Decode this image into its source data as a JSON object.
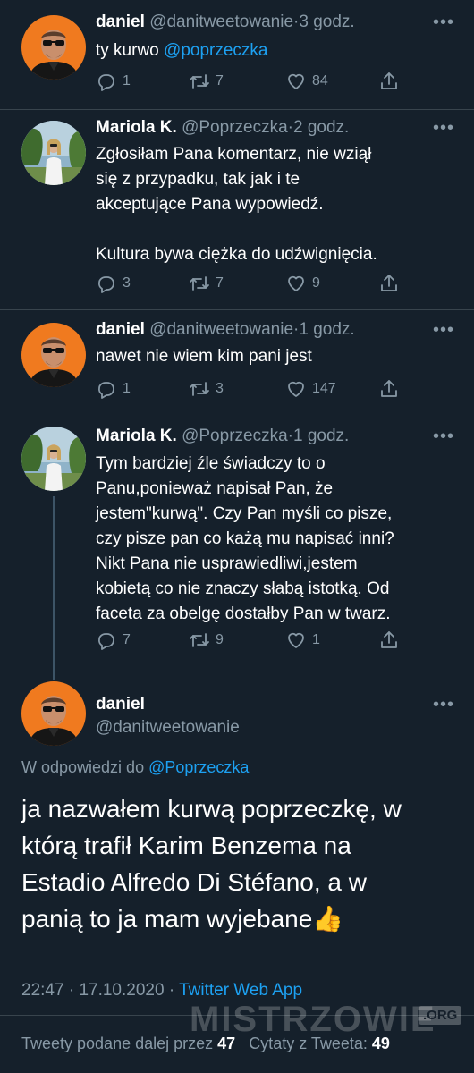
{
  "colors": {
    "background": "#15202b",
    "text": "#ffffff",
    "muted": "#8899a6",
    "link": "#1da1f2"
  },
  "tweets": [
    {
      "name": "daniel",
      "handle": "@danitweetowanie",
      "sep": "·",
      "time": "3 godz.",
      "text": "ty kurwo ",
      "mention": "@poprzeczka",
      "replies": "1",
      "retweets": "7",
      "likes": "84"
    },
    {
      "name": "Mariola K.",
      "handle": "@Poprzeczka",
      "sep": "·",
      "time": "2 godz.",
      "text_lines": [
        "Zgłosiłam Pana komentarz, nie wziął",
        "się z przypadku, tak jak i te",
        "akceptujące Pana wypowiedź.",
        "",
        "Kultura bywa ciężka do udźwignięcia."
      ],
      "replies": "3",
      "retweets": "7",
      "likes": "9"
    },
    {
      "name": "daniel",
      "handle": "@danitweetowanie",
      "sep": "·",
      "time": "1 godz.",
      "text": "nawet nie wiem kim pani jest",
      "replies": "1",
      "retweets": "3",
      "likes": "147"
    },
    {
      "name": "Mariola K.",
      "handle": "@Poprzeczka",
      "sep": "·",
      "time": "1 godz.",
      "text_lines": [
        "Tym bardziej źle świadczy to o",
        "Panu,ponieważ napisał Pan, że",
        "jestem\"kurwą\". Czy Pan myśli co pisze,",
        "czy pisze pan co każą mu napisać inni?",
        "Nikt Pana nie usprawiedliwi,jestem",
        "kobietą co nie znaczy słabą istotką. Od",
        "faceta za obelgę dostałby Pan w twarz."
      ],
      "replies": "7",
      "retweets": "9",
      "likes": "1"
    }
  ],
  "main_tweet": {
    "name": "daniel",
    "handle": "@danitweetowanie",
    "reply_prefix": "W odpowiedzi do ",
    "reply_to": "@Poprzeczka",
    "text_lines": [
      "ja nazwałem kurwą poprzeczkę, w",
      "którą trafił Karim Benzema na",
      "Estadio Alfredo Di Stéfano, a w",
      "panią to ja mam wyjebane👍"
    ],
    "time": "22:47",
    "sep": "·",
    "date": "17.10.2020",
    "source": "Twitter Web App",
    "retweets_label": "Tweety podane dalej przez ",
    "retweets_count": "47",
    "quotes_label": "Cytaty z Tweeta: ",
    "quotes_count": "49"
  },
  "watermark": {
    "text": "MISTRZOWIE",
    "suffix": ".ORG"
  },
  "icons": [
    "more-icon",
    "reply-icon",
    "retweet-icon",
    "like-icon",
    "share-icon"
  ]
}
